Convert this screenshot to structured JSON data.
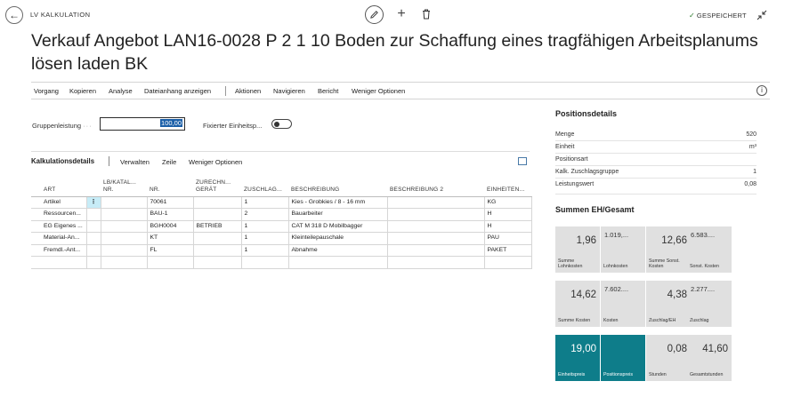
{
  "top": {
    "caption": "LV KALKULATION",
    "saved": "GESPEICHERT"
  },
  "title": "Verkauf Angebot LAN16-0028 P 2 1 10 Boden zur Schaffung eines tragfähigen Arbeitsplanums lösen laden BK",
  "actions": [
    "Vorgang",
    "Kopieren",
    "Analyse",
    "Dateianhang anzeigen",
    "Aktionen",
    "Navigieren",
    "Bericht",
    "Weniger Optionen"
  ],
  "fields": {
    "group_label": "Gruppenleistung",
    "group_value": "100,00",
    "fixed_label": "Fixierter Einheitsp..."
  },
  "lines": {
    "title": "Kalkulationsdetails",
    "actions": [
      "Verwalten",
      "Zeile",
      "Weniger Optionen"
    ],
    "columns": [
      "ART",
      "",
      "LB/KATAL... NR.",
      "NR.",
      "ZURECHN... GERÄT",
      "ZUSCHLAG...",
      "BESCHREIBUNG",
      "BESCHREIBUNG 2",
      "EINHEITEN..."
    ],
    "rows": [
      {
        "art": "Artikel",
        "lb": "",
        "nr": "70061",
        "geraet": "",
        "zuschlag": "1",
        "beschreibung": "Kies - Grobkies / 8 - 16 mm",
        "beschreibung2": "",
        "einheit": "KG"
      },
      {
        "art": "Ressourcen...",
        "lb": "",
        "nr": "BAU-1",
        "geraet": "",
        "zuschlag": "2",
        "beschreibung": "Bauarbeiter",
        "beschreibung2": "",
        "einheit": "H"
      },
      {
        "art": "EG Eigenes ...",
        "lb": "",
        "nr": "BGH0004",
        "geraet": "BETRIEB",
        "zuschlag": "1",
        "beschreibung": "CAT M 318 D Mobilbagger",
        "beschreibung2": "",
        "einheit": "H"
      },
      {
        "art": "Material-An...",
        "lb": "",
        "nr": "KT",
        "geraet": "",
        "zuschlag": "1",
        "beschreibung": "Kleinteilepauschale",
        "beschreibung2": "",
        "einheit": "PAU"
      },
      {
        "art": "Fremdl.-Ant...",
        "lb": "",
        "nr": "FL",
        "geraet": "",
        "zuschlag": "1",
        "beschreibung": "Abnahme",
        "beschreibung2": "",
        "einheit": "PAKET"
      }
    ]
  },
  "details": {
    "title": "Positionsdetails",
    "items": [
      {
        "label": "Menge",
        "value": "520"
      },
      {
        "label": "Einheit",
        "value": "m³"
      },
      {
        "label": "Positionsart",
        "value": ""
      },
      {
        "label": "Kalk. Zuschlagsgruppe",
        "value": "1"
      },
      {
        "label": "Leistungswert",
        "value": "0,08"
      }
    ]
  },
  "sums": {
    "title": "Summen EH/Gesamt",
    "tiles": [
      {
        "value": "1,96",
        "label": "Summe Lohnkosten"
      },
      {
        "value": "1.019,...",
        "label": "Lohnkosten"
      },
      {
        "value": "12,66",
        "label": "Summe Sonst. Kosten"
      },
      {
        "value": "6.583....",
        "label": "Sonst. Kosten"
      },
      {
        "value": "14,62",
        "label": "Summe Kosten"
      },
      {
        "value": "7.602....",
        "label": "Kosten"
      },
      {
        "value": "4,38",
        "label": "Zuschlag/EH"
      },
      {
        "value": "2.277....",
        "label": "Zuschlag"
      },
      {
        "value": "19,00",
        "label": "Einheitspreis"
      },
      {
        "value": "",
        "label": "Positionspreis"
      },
      {
        "value": "0,08",
        "label": "Stunden"
      },
      {
        "value": "41,60",
        "label": "Gesamtstunden"
      }
    ]
  },
  "colors": {
    "accent_tile": "#0e7d8a",
    "tile": "#e0e0e0",
    "selected_cell": "#c7ecf7"
  }
}
